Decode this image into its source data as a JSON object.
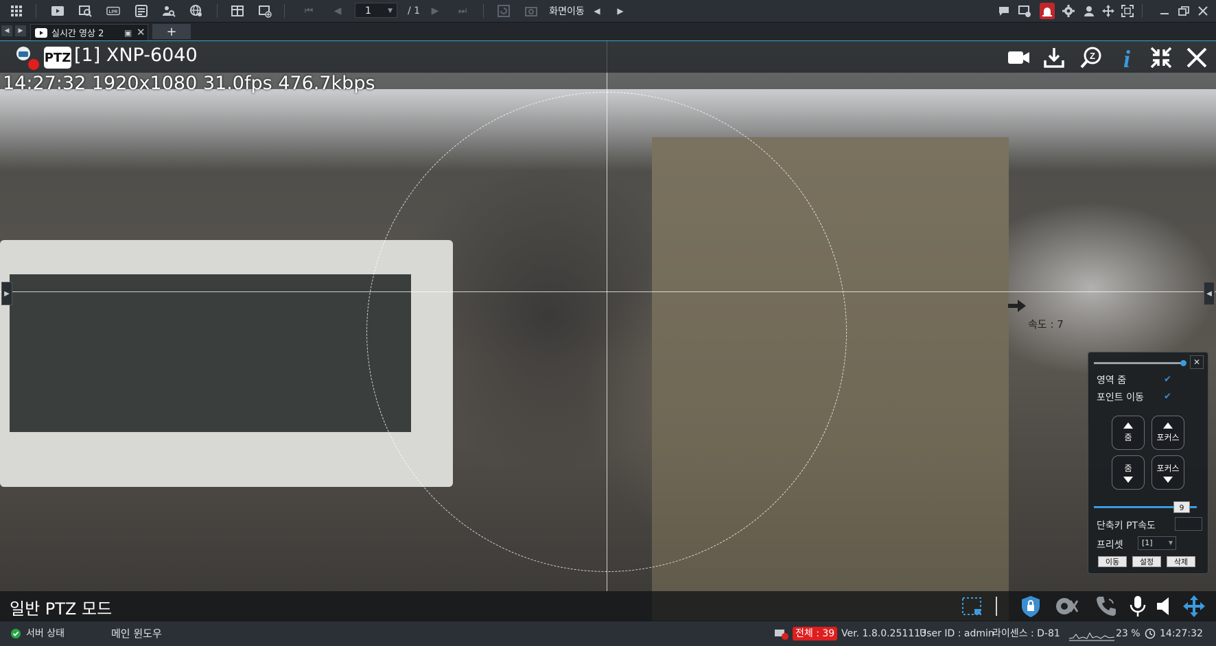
{
  "toolbar": {
    "page_current": "1",
    "page_total": "/ 1",
    "screen_move_label": "화면이동"
  },
  "tabs": [
    {
      "label": "실시간 영상 2"
    }
  ],
  "camera": {
    "ptz_badge": "PTZ",
    "title": "[1] XNP-6040",
    "info": "14:27:32 1920x1080 31.0fps 476.7kbps",
    "speed_label": "속도 : 7",
    "mode_label": "일반 PTZ 모드"
  },
  "ptz_panel": {
    "area_zoom_label": "영역 줌",
    "area_zoom_checked": true,
    "point_move_label": "포인트 이동",
    "point_move_checked": true,
    "zoom_in_label": "줌",
    "focus_near_label": "포커스",
    "zoom_out_label": "줌",
    "focus_far_label": "포커스",
    "speed_value": "9",
    "hotkey_pt_speed_label": "단축키 PT속도",
    "preset_label": "프리셋",
    "preset_value": "[1]",
    "move_button": "이동",
    "set_button": "설정",
    "delete_button": "삭제"
  },
  "statusbar": {
    "server_status": "서버 상태",
    "main_window": "메인 윈도우",
    "total_label": "전체 : 39",
    "version": "Ver. 1.8.0.251113",
    "user_id": "User ID : admin",
    "license": "라이센스 : D-81",
    "cpu": "23 %",
    "clock": "14:27:32"
  },
  "colors": {
    "accent": "#3aa0c8",
    "alert_red": "#e01e1e",
    "check_blue": "#3a8ee0"
  }
}
